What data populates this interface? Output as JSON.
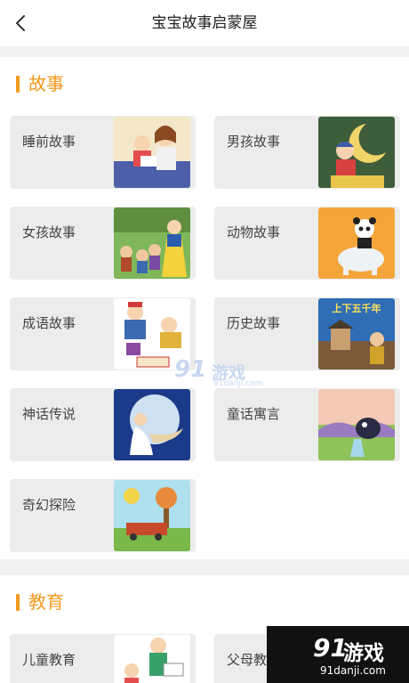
{
  "header": {
    "title": "宝宝故事启蒙屋",
    "back_icon": "chevron-left-icon"
  },
  "sections": [
    {
      "title": "故事",
      "accent": "#f39a1e",
      "items": [
        {
          "label": "睡前故事"
        },
        {
          "label": "男孩故事"
        },
        {
          "label": "女孩故事"
        },
        {
          "label": "动物故事"
        },
        {
          "label": "成语故事"
        },
        {
          "label": "历史故事",
          "thumb_text": "上下五千年"
        },
        {
          "label": "神话传说"
        },
        {
          "label": "童话寓言"
        },
        {
          "label": "奇幻探险"
        }
      ]
    },
    {
      "title": "教育",
      "accent": "#f39a1e",
      "items": [
        {
          "label": "儿童教育"
        },
        {
          "label": "父母教育"
        }
      ]
    }
  ],
  "watermark": {
    "number": "91",
    "text": "游戏",
    "url": "91danji.com"
  },
  "corner_logo": {
    "number": "91",
    "text": "游戏",
    "url": "91danji.com"
  }
}
